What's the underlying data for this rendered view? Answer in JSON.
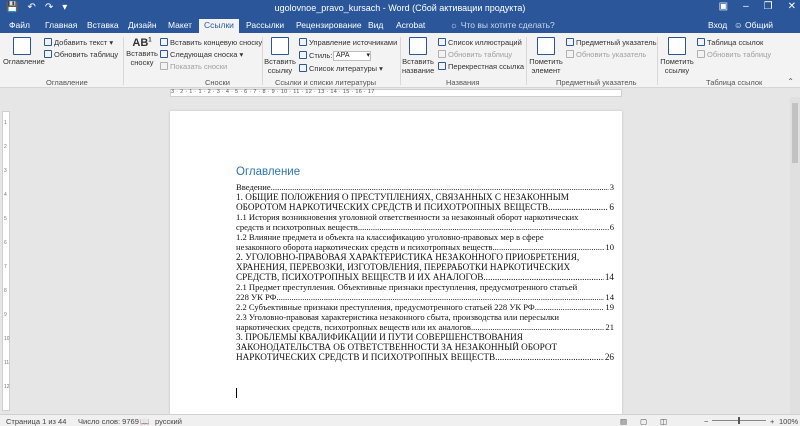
{
  "window": {
    "title": "ugolovnoe_pravo_kursach - Word (Сбой активации продукта)",
    "qat_icons": [
      "save-icon",
      "undo-icon",
      "redo-icon",
      "customize-icon"
    ],
    "controls": [
      "minimize-icon",
      "restore-icon",
      "close-icon"
    ]
  },
  "tabs": [
    {
      "label": "Файл",
      "active": false
    },
    {
      "label": "Главная",
      "active": false
    },
    {
      "label": "Вставка",
      "active": false
    },
    {
      "label": "Дизайн",
      "active": false
    },
    {
      "label": "Макет",
      "active": false
    },
    {
      "label": "Ссылки",
      "active": true
    },
    {
      "label": "Рассылки",
      "active": false
    },
    {
      "label": "Рецензирование",
      "active": false
    },
    {
      "label": "Вид",
      "active": false
    },
    {
      "label": "Acrobat",
      "active": false
    }
  ],
  "tellme": "Что вы хотите сделать?",
  "account": {
    "signin": "Вход",
    "share": "Общий доступ"
  },
  "ribbon": {
    "toc": {
      "button": "Оглавление",
      "add_text": "Добавить текст",
      "update_table": "Обновить таблицу",
      "group": "Оглавление"
    },
    "footnotes": {
      "insert_footnote": "Вставить",
      "insert_footnote2": "сноску",
      "insert_endnote": "Вставить концевую сноску",
      "next_footnote": "Следующая сноска",
      "show_notes": "Показать сноски",
      "group": "Сноски"
    },
    "citations": {
      "insert_citation": "Вставить",
      "insert_citation2": "ссылку",
      "manage_sources": "Управление источниками",
      "style_label": "Стиль:",
      "style_value": "APA",
      "bibliography": "Список литературы",
      "group": "Ссылки и списки литературы"
    },
    "captions": {
      "insert_caption": "Вставить",
      "insert_caption2": "название",
      "insert_tof": "Список иллюстраций",
      "update_table": "Обновить таблицу",
      "cross_ref": "Перекрестная ссылка",
      "group": "Названия"
    },
    "index": {
      "mark_entry": "Пометить",
      "mark_entry2": "элемент",
      "insert_index": "Предметный указатель",
      "update_index": "Обновить указатель",
      "group": "Предметный указатель"
    },
    "toa": {
      "mark_citation": "Пометить",
      "mark_citation2": "ссылку",
      "insert_toa": "Таблица ссылок",
      "update_table": "Обновить таблицу",
      "group": "Таблица ссылок"
    }
  },
  "ruler": "3 · 2 · 1 · 1 · 2 · 3 · 4 · 5 · 6 · 7 · 8 · 9 · 10 · 11 · 12 · 13 · 14 · 15 · 16 · 17",
  "vruler": [
    "1",
    "2",
    "3",
    "4",
    "5",
    "6",
    "7",
    "8",
    "9",
    "10",
    "11",
    "12"
  ],
  "document": {
    "toc_title": "Оглавление",
    "entries": [
      {
        "lines": [
          "Введение"
        ],
        "page": "3",
        "style": "normal"
      },
      {
        "lines": [
          "1. ОБЩИЕ ПОЛОЖЕНИЯ О ПРЕСТУПЛЕНИЯХ, СВЯЗАННЫХ С НЕЗАКОННЫМ",
          "ОБОРОТОМ НАРКОТИЧЕСКИХ СРЕДСТВ И ПСИХОТРОПНЫХ ВЕЩЕСТВ"
        ],
        "page": "6",
        "style": "heading"
      },
      {
        "lines": [
          "1.1 История возникновения уголовной ответственности за незаконный оборот наркотических",
          "средств и психотропных веществ"
        ],
        "page": "6",
        "style": "normal"
      },
      {
        "lines": [
          "1.2 Влияние предмета и объекта на классификацию уголовно-правовых мер в сфере",
          "незаконного оборота наркотических средств и психотропных веществ"
        ],
        "page": "10",
        "style": "normal"
      },
      {
        "lines": [
          "2. УГОЛОВНО-ПРАВОВАЯ ХАРАКТЕРИСТИКА НЕЗАКОННОГО ПРИОБРЕТЕНИЯ,",
          "ХРАНЕНИЯ, ПЕРЕВОЗКИ, ИЗГОТОВЛЕНИЯ, ПЕРЕРАБОТКИ НАРКОТИЧЕСКИХ",
          "СРЕДСТВ, ПСИХОТРОПНЫХ ВЕЩЕСТВ И ИХ АНАЛОГОВ"
        ],
        "page": "14",
        "style": "heading"
      },
      {
        "lines": [
          "2.1 Предмет преступления. Объективные признаки преступления, предусмотренного статьей",
          "228 УК РФ"
        ],
        "page": "14",
        "style": "normal"
      },
      {
        "lines": [
          "2.2 Субъективные признаки преступления, предусмотренного статьей 228 УК РФ"
        ],
        "page": "19",
        "style": "normal"
      },
      {
        "lines": [
          "2.3 Уголовно-правовая характеристика незаконного сбыта, производства или пересылки",
          "наркотических средств, психотропных веществ или их аналогов"
        ],
        "page": "21",
        "style": "normal"
      },
      {
        "lines": [
          "3. ПРОБЛЕМЫ КВАЛИФИКАЦИИ И ПУТИ СОВЕРШЕНСТВОВАНИЯ",
          "ЗАКОНОДАТЕЛЬСТВА ОБ ОТВЕТСТВЕННОСТИ ЗА НЕЗАКОННЫЙ ОБОРОТ",
          "НАРКОТИЧЕСКИХ СРЕДСТВ И ПСИХОТРОПНЫХ ВЕЩЕСТВ"
        ],
        "page": "26",
        "style": "heading"
      }
    ]
  },
  "status": {
    "page": "Страница 1 из 44",
    "words": "Число слов: 9769",
    "language": "русский",
    "zoom_minus": "−",
    "zoom_plus": "+",
    "zoom": "100%"
  },
  "colors": {
    "accent": "#2b579a",
    "toc_title": "#2e74b5"
  }
}
